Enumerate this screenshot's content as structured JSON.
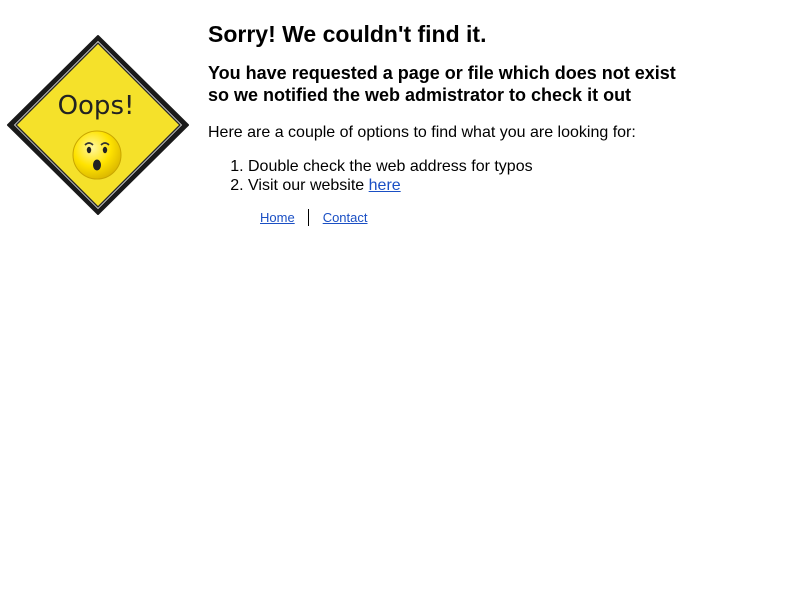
{
  "sign": {
    "text": "Oops!",
    "colors": {
      "fill": "#f5e12a",
      "border": "#1a1a1a",
      "face": "#ffe600"
    }
  },
  "heading": "Sorry! We couldn't find it.",
  "subheading_line1": "You have requested a page or file which does not exist",
  "subheading_line2": "so we notified the web admistrator to check it out",
  "intro": "Here are a couple of options to find what you are looking for:",
  "options": [
    {
      "text": "Double check the web address for typos"
    },
    {
      "text": "Visit our website ",
      "link_text": "here"
    }
  ],
  "footer_links": {
    "home": "Home",
    "contact": "Contact"
  },
  "colors": {
    "link": "#1a4fc4"
  }
}
